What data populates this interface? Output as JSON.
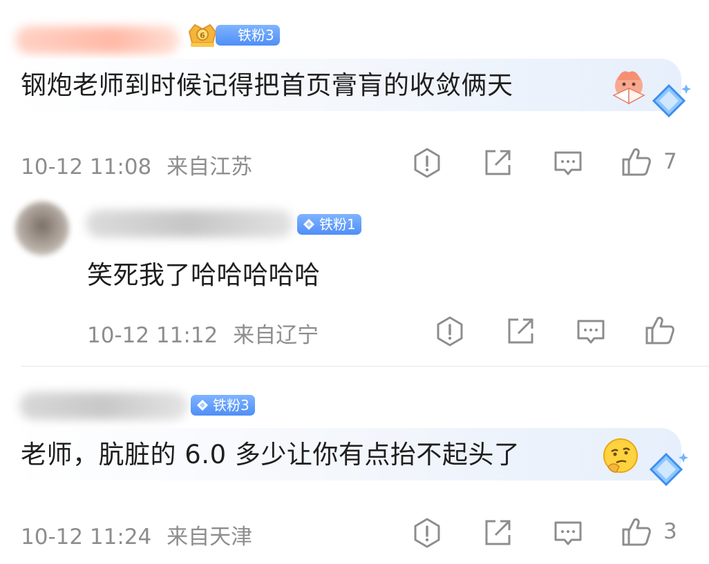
{
  "comments": [
    {
      "badge": "铁粉3",
      "text": "钢炮老师到时候记得把首页膏肓的收敛俩天",
      "time": "10-12 11:08",
      "location": "来自江苏",
      "likes": "7",
      "sticker": "fan-face-emoji"
    },
    {
      "badge": "铁粉1",
      "text": "笑死我了哈哈哈哈哈",
      "time": "10-12 11:12",
      "location": "来自辽宁",
      "likes": ""
    },
    {
      "badge": "铁粉3",
      "text": "老师，肮脏的 6.0 多少让你有点抬不起头了",
      "time": "10-12 11:24",
      "location": "来自天津",
      "likes": "3",
      "sticker": "thinking-face-emoji"
    }
  ],
  "colors": {
    "badge_blue": "#4f8ef7",
    "meta_gray": "#8d8d8d",
    "text": "#1f1f1f"
  }
}
